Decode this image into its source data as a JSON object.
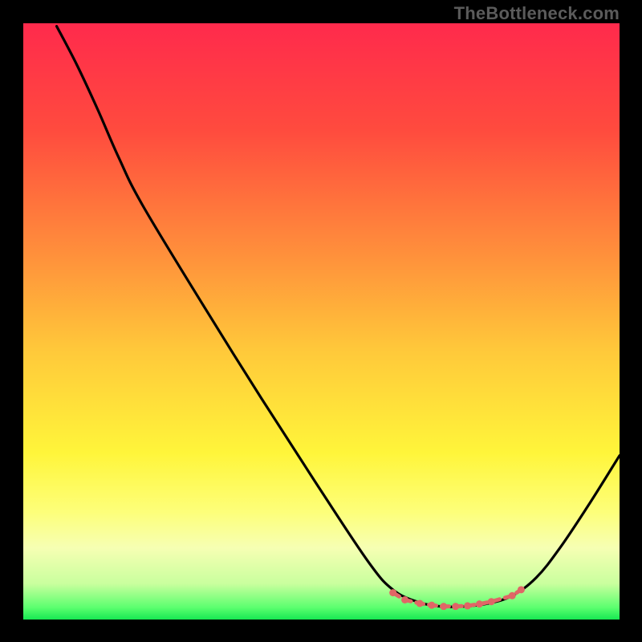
{
  "watermark": "TheBottleneck.com",
  "chart_data": {
    "type": "line",
    "title": "",
    "xlabel": "",
    "ylabel": "",
    "x_range": [
      0,
      100
    ],
    "y_range": [
      0,
      100
    ],
    "gradient_stops": [
      {
        "offset": 0,
        "color": "#ff2a4c"
      },
      {
        "offset": 18,
        "color": "#ff4b3e"
      },
      {
        "offset": 40,
        "color": "#ff943b"
      },
      {
        "offset": 55,
        "color": "#ffc93a"
      },
      {
        "offset": 72,
        "color": "#fff53a"
      },
      {
        "offset": 82,
        "color": "#fdff7a"
      },
      {
        "offset": 88,
        "color": "#f6ffb3"
      },
      {
        "offset": 94,
        "color": "#c9ff9e"
      },
      {
        "offset": 98,
        "color": "#5bff6f"
      },
      {
        "offset": 100,
        "color": "#17e852"
      }
    ],
    "series": [
      {
        "name": "bottleneck-curve",
        "stroke": "#000000",
        "points": [
          {
            "x": 5.6,
            "y": 99.5
          },
          {
            "x": 9.0,
            "y": 93.0
          },
          {
            "x": 12.5,
            "y": 85.5
          },
          {
            "x": 16.0,
            "y": 77.5
          },
          {
            "x": 20.0,
            "y": 69.5
          },
          {
            "x": 30.0,
            "y": 53.0
          },
          {
            "x": 40.0,
            "y": 37.0
          },
          {
            "x": 50.0,
            "y": 21.5
          },
          {
            "x": 58.0,
            "y": 9.5
          },
          {
            "x": 62.0,
            "y": 5.0
          },
          {
            "x": 66.0,
            "y": 3.0
          },
          {
            "x": 70.0,
            "y": 2.2
          },
          {
            "x": 74.0,
            "y": 2.2
          },
          {
            "x": 78.0,
            "y": 2.7
          },
          {
            "x": 82.0,
            "y": 4.0
          },
          {
            "x": 86.0,
            "y": 7.0
          },
          {
            "x": 90.0,
            "y": 12.0
          },
          {
            "x": 95.0,
            "y": 19.5
          },
          {
            "x": 100.0,
            "y": 27.5
          }
        ]
      },
      {
        "name": "optimal-band-markers",
        "stroke": "#e06666",
        "marker": "circle",
        "points": [
          {
            "x": 62.0,
            "y": 4.5
          },
          {
            "x": 64.0,
            "y": 3.3
          },
          {
            "x": 66.5,
            "y": 2.7
          },
          {
            "x": 68.5,
            "y": 2.4
          },
          {
            "x": 70.5,
            "y": 2.2
          },
          {
            "x": 72.5,
            "y": 2.2
          },
          {
            "x": 74.5,
            "y": 2.3
          },
          {
            "x": 76.5,
            "y": 2.6
          },
          {
            "x": 78.5,
            "y": 3.0
          },
          {
            "x": 82.0,
            "y": 4.0
          },
          {
            "x": 83.5,
            "y": 5.0
          }
        ]
      }
    ]
  }
}
